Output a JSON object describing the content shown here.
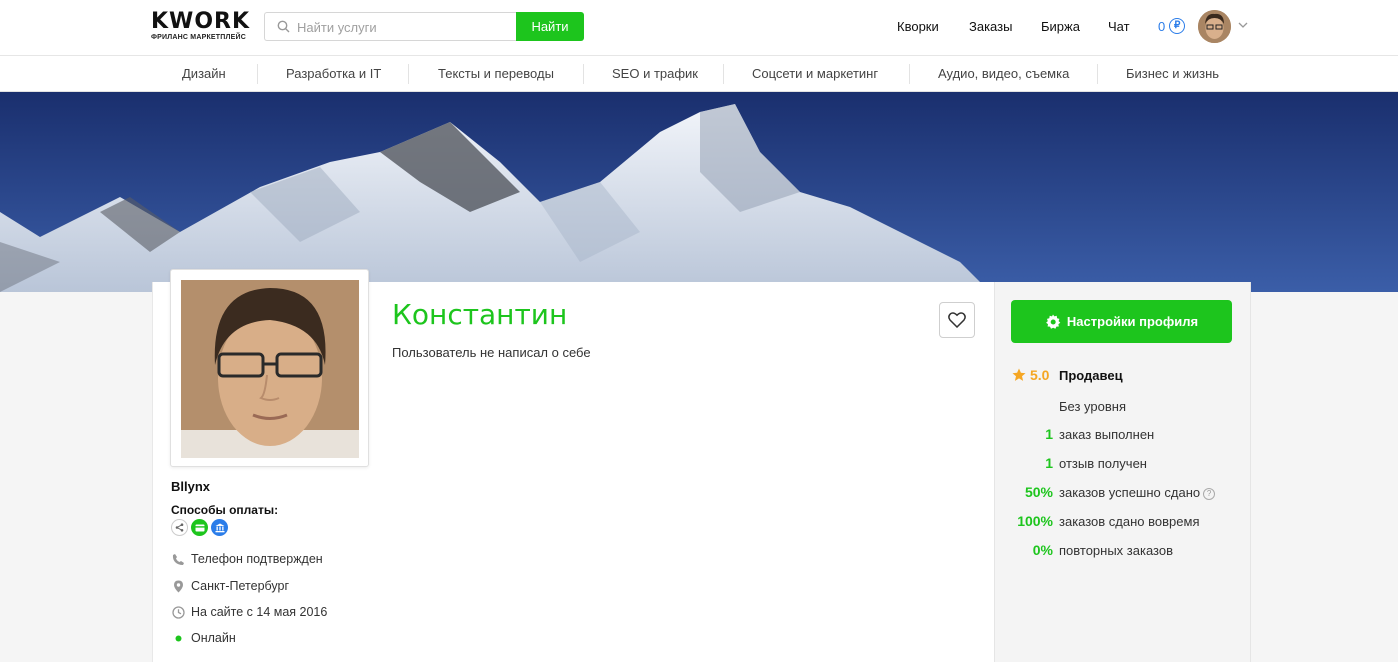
{
  "logo": {
    "main": "KWORK",
    "sub": "ФРИЛАНС МАРКЕТПЛЕЙС"
  },
  "search": {
    "placeholder": "Найти услуги",
    "button": "Найти"
  },
  "topnav": [
    "Кворки",
    "Заказы",
    "Биржа",
    "Чат"
  ],
  "balance": {
    "amount": "0",
    "currency_symbol": "₽"
  },
  "categories": [
    "Дизайн",
    "Разработка и IT",
    "Тексты и переводы",
    "SEO и трафик",
    "Соцсети и маркетинг",
    "Аудио, видео, съемка",
    "Бизнес и жизнь"
  ],
  "profile": {
    "name": "Константин",
    "about": "Пользователь не написал о себе",
    "username": "Bllynx",
    "payment_label": "Способы оплаты:",
    "phone": "Телефон подтвержден",
    "city": "Санкт-Петербург",
    "since": "На сайте с 14 мая 2016",
    "status": "Онлайн"
  },
  "sidebar": {
    "settings_button": "Настройки профиля",
    "rating": "5.0",
    "role": "Продавец",
    "level": "Без уровня",
    "stats": [
      {
        "value": "1",
        "label": "заказ выполнен"
      },
      {
        "value": "1",
        "label": "отзыв получен"
      },
      {
        "value": "50%",
        "label": "заказов успешно сдано"
      },
      {
        "value": "100%",
        "label": "заказов сдано вовремя"
      },
      {
        "value": "0%",
        "label": "повторных заказов"
      }
    ]
  },
  "colors": {
    "accent": "#1dc51d",
    "link": "#2b7de9",
    "star": "#f5a623"
  },
  "icons": [
    "search-icon",
    "ruble-icon",
    "chevron-down-icon",
    "heart-icon",
    "gear-icon",
    "star-icon",
    "phone-icon",
    "location-icon",
    "clock-icon",
    "online-dot-icon",
    "question-icon"
  ]
}
